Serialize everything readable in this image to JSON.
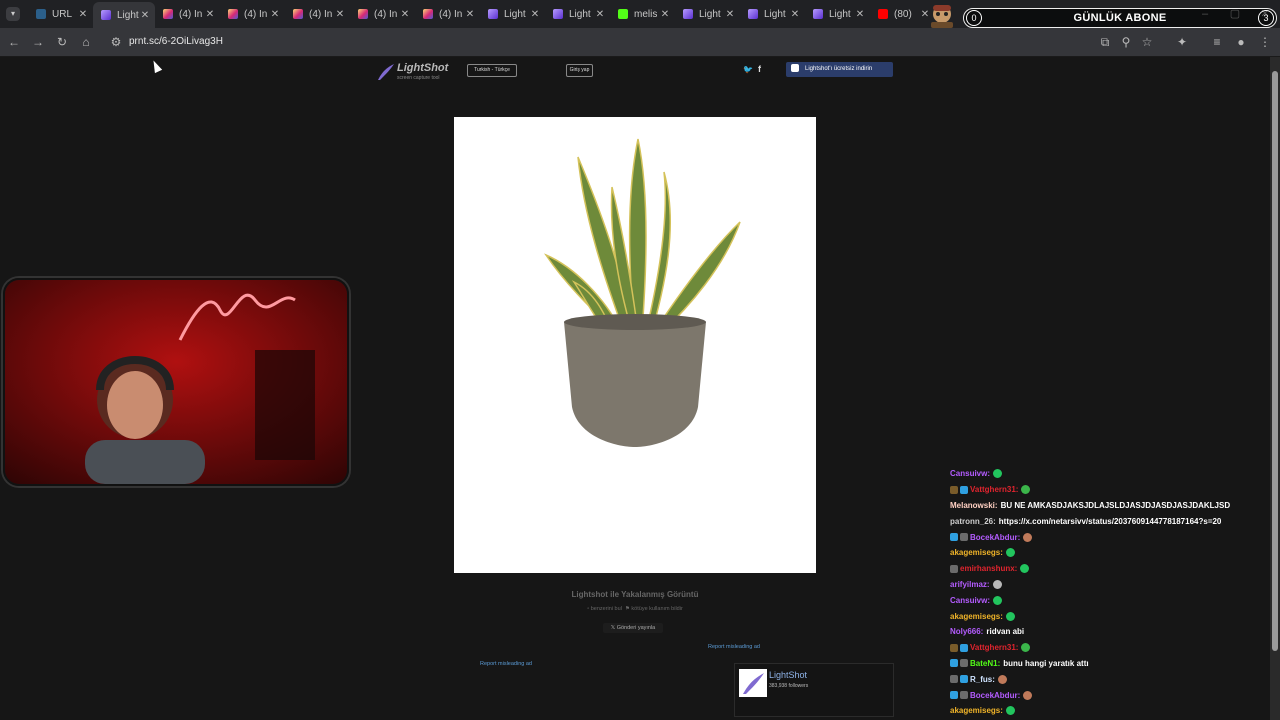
{
  "tabs": [
    {
      "label": "URL",
      "fav": "fav-url",
      "active": false
    },
    {
      "label": "Light",
      "fav": "fav-lightshot",
      "active": true
    },
    {
      "label": "(4) In",
      "fav": "fav-insta",
      "active": false
    },
    {
      "label": "(4) In",
      "fav": "fav-insta",
      "active": false
    },
    {
      "label": "(4) In",
      "fav": "fav-insta",
      "active": false
    },
    {
      "label": "(4) In",
      "fav": "fav-insta",
      "active": false
    },
    {
      "label": "(4) In",
      "fav": "fav-insta",
      "active": false
    },
    {
      "label": "Light",
      "fav": "fav-lightshot",
      "active": false
    },
    {
      "label": "Light",
      "fav": "fav-lightshot",
      "active": false
    },
    {
      "label": "melis",
      "fav": "fav-kick",
      "active": false
    },
    {
      "label": "Light",
      "fav": "fav-lightshot",
      "active": false
    },
    {
      "label": "Light",
      "fav": "fav-lightshot",
      "active": false
    },
    {
      "label": "Light",
      "fav": "fav-lightshot",
      "active": false
    },
    {
      "label": "(80)",
      "fav": "fav-yt",
      "active": false
    }
  ],
  "overlay": {
    "text": "GÜNLÜK ABONE",
    "count_left": "0",
    "count_right": "3"
  },
  "browser": {
    "url": "prnt.sc/6-2OiLivag3H"
  },
  "lightshot": {
    "brand": "LightShot",
    "tagline": "screen capture tool",
    "language": "Turkish - Türkçe",
    "login": "Giriş yap",
    "download": "Lightshot'ı ücretsiz indirin",
    "caption": "Lightshot ile Yakalanmış Görüntü",
    "similar": "benzerini bul",
    "report_abuse": "kötüye kullanım bildir",
    "tweet": "Gönderi yayınla",
    "report_ad": "Report misleading ad",
    "page_name": "LightShot",
    "page_followers": "383,938 followers"
  },
  "chat": [
    {
      "user": "Cansuivw:",
      "color": "#b45cff",
      "msg": "",
      "badges": [],
      "emote": "#22c55e"
    },
    {
      "user": "Vattghern31:",
      "color": "#e0242e",
      "msg": "",
      "badges": [
        "#7a5c2a",
        "#2fa0e0"
      ],
      "emote": "#3bb54a"
    },
    {
      "user": "Melanowski:",
      "color": "#ffd0c2",
      "msg": "BU NE AMKASDJAKSJDLAJSLDJASJDJASDJASJDAKLJSD",
      "badges": [],
      "emote": ""
    },
    {
      "user": "patronn_26:",
      "color": "#cfcfcf",
      "msg": "https://x.com/netarsivv/status/2037609144778187164?s=20",
      "badges": [],
      "emote": ""
    },
    {
      "user": "BocekAbdur:",
      "color": "#b45cff",
      "msg": "",
      "badges": [
        "#2fa0e0",
        "#6b6b6b"
      ],
      "emote": "#c07a5a"
    },
    {
      "user": "akagemisegs:",
      "color": "#f0b429",
      "msg": "",
      "badges": [],
      "emote": "#22c55e"
    },
    {
      "user": "emirhanshunx:",
      "color": "#e0242e",
      "msg": "",
      "badges": [
        "#6b6b6b"
      ],
      "emote": "#22c55e"
    },
    {
      "user": "arifyilmaz:",
      "color": "#b45cff",
      "msg": "",
      "badges": [],
      "emote": "#b8b8b8"
    },
    {
      "user": "Cansuivw:",
      "color": "#b45cff",
      "msg": "",
      "badges": [],
      "emote": "#22c55e"
    },
    {
      "user": "akagemisegs:",
      "color": "#f0b429",
      "msg": "",
      "badges": [],
      "emote": "#22c55e"
    },
    {
      "user": "Noly666:",
      "color": "#b45cff",
      "msg": "ridvan abi",
      "badges": [],
      "emote": ""
    },
    {
      "user": "Vattghern31:",
      "color": "#e0242e",
      "msg": "",
      "badges": [
        "#7a5c2a",
        "#2fa0e0"
      ],
      "emote": "#3bb54a"
    },
    {
      "user": "BateN1:",
      "color": "#53fc18",
      "msg": "bunu hangi yaratık attı",
      "badges": [
        "#2fa0e0",
        "#6b6b6b"
      ],
      "emote": ""
    },
    {
      "user": "R_fus:",
      "color": "#cfe3ff",
      "msg": "",
      "badges": [
        "#6b6b6b",
        "#2fa0e0"
      ],
      "emote": "#c07a5a"
    },
    {
      "user": "BocekAbdur:",
      "color": "#b45cff",
      "msg": "",
      "badges": [
        "#2fa0e0",
        "#6b6b6b"
      ],
      "emote": "#c07a5a"
    },
    {
      "user": "akagemisegs:",
      "color": "#f0b429",
      "msg": "",
      "badges": [],
      "emote": "#22c55e"
    }
  ]
}
